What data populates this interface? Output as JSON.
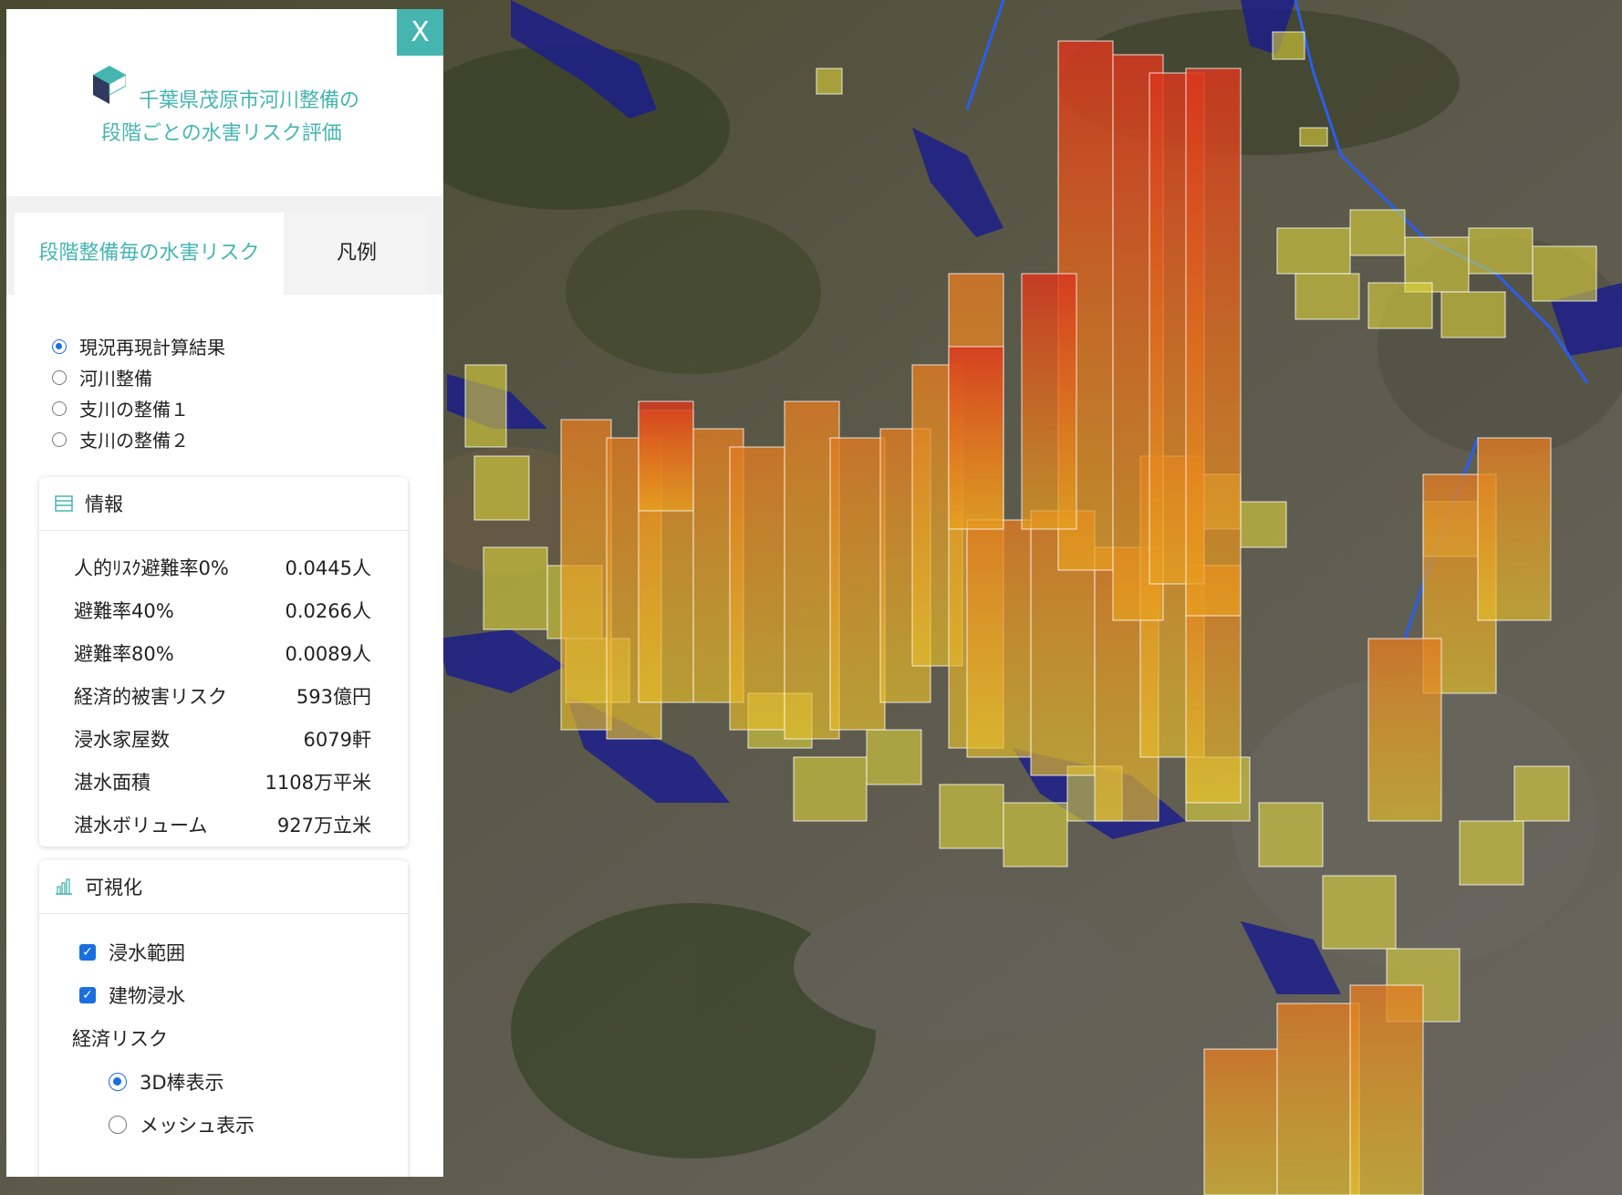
{
  "header": {
    "title_line1": "千葉県茂原市河川整備の",
    "title_line2": "段階ごとの水害リスク評価",
    "close_label": "X"
  },
  "tabs": [
    {
      "label": "段階整備毎の水害リスク",
      "active": true
    },
    {
      "label": "凡例",
      "active": false
    }
  ],
  "scenarios": {
    "selected": 0,
    "options": [
      "現況再現計算結果",
      "河川整備",
      "支川の整備１",
      "支川の整備２"
    ]
  },
  "info": {
    "title": "情報",
    "rows": [
      {
        "label": "人的ﾘｽｸ避難率0%",
        "value": "0.0445人"
      },
      {
        "label": "避難率40%",
        "value": "0.0266人"
      },
      {
        "label": "避難率80%",
        "value": "0.0089人"
      },
      {
        "label": "経済的被害リスク",
        "value": "593億円"
      },
      {
        "label": "浸水家屋数",
        "value": "6079軒"
      },
      {
        "label": "湛水面積",
        "value": "1108万平米"
      },
      {
        "label": "湛水ボリューム",
        "value": "927万立米"
      }
    ]
  },
  "visualization": {
    "title": "可視化",
    "checkboxes": [
      {
        "label": "浸水範囲",
        "checked": true
      },
      {
        "label": "建物浸水",
        "checked": true
      }
    ],
    "economic_risk_label": "経済リスク",
    "economic_risk_options": [
      {
        "label": "3D棒表示",
        "selected": true
      },
      {
        "label": "メッシュ表示",
        "selected": false
      }
    ]
  },
  "colors": {
    "accent": "#46b5b0",
    "radio_blue": "#1a6fe0",
    "flood_blue": "#1c1f8a",
    "bar_high": "#d8361e",
    "bar_mid": "#e8a21e",
    "bar_low": "#eadf3a"
  },
  "icons": {
    "logo": "cube-logo-icon",
    "info": "list-icon",
    "visualization": "bar-chart-icon",
    "close": "close-icon"
  }
}
